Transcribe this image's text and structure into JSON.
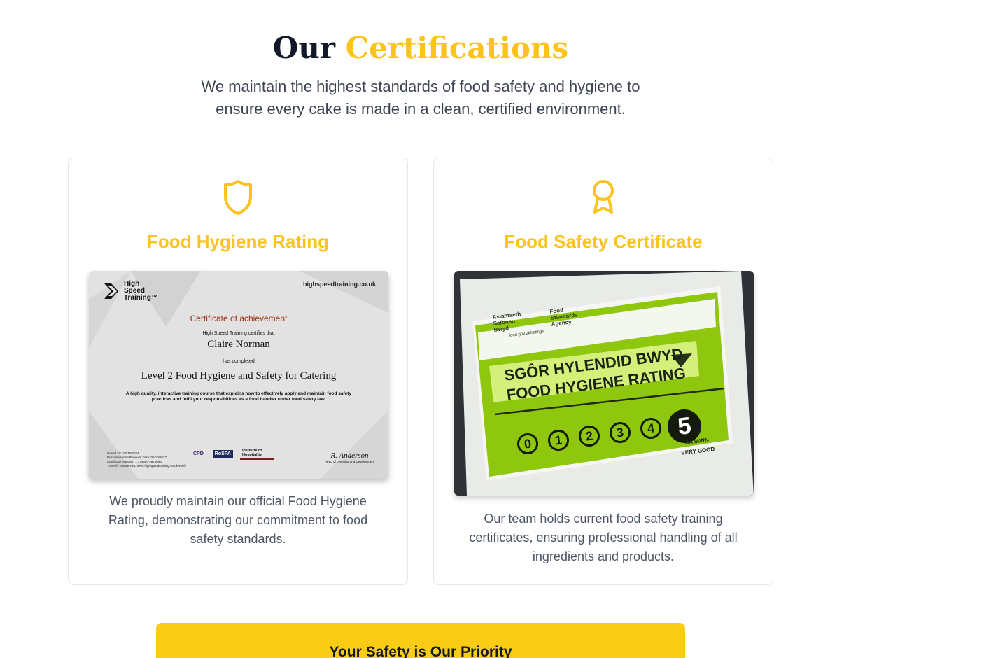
{
  "header": {
    "title_part1": "Our",
    "title_part2": "Certifications",
    "intro_line1": "We maintain the highest standards of food safety and hygiene to",
    "intro_line2": "ensure every cake is made in a clean, certified environment."
  },
  "cards": [
    {
      "title": "Food Hygiene Rating",
      "icon": "shield-icon",
      "desc_line1": "We proudly maintain our official Food Hygiene",
      "desc_line2": "Rating, demonstrating our commitment to food",
      "desc_line3": "safety standards."
    },
    {
      "title": "Food Safety Certificate",
      "icon": "award-ribbon-icon",
      "desc_line1": "Our team holds current food safety training",
      "desc_line2": "certificates, ensuring professional handling of all",
      "desc_line3": "ingredients and products."
    }
  ],
  "certificate": {
    "brand_line1": "High",
    "brand_line2": "Speed",
    "brand_line3": "Training™",
    "url": "highspeedtraining.co.uk",
    "heading": "Certificate of achievement",
    "certifies": "High Speed Training certifies that",
    "name": "Claire Norman",
    "completed": "has completed",
    "course": "Level 2 Food Hygiene and Safety for Catering",
    "description_line1": "A high quality, interactive training course that explains how to effectively apply and maintain food safety",
    "description_line2": "practices and fulfil your responsibilities as a food handler under food safety law.",
    "meta_line1": "Issued On: 06/10/2024",
    "meta_line2": "Recommended Renewal Date: 06/10/2027",
    "meta_line3": "Certificate Number: 7,774850-4678096",
    "meta_line4": "To verify please visit: www.highspeedtraining.co.uk/verify",
    "logo1": "CPD",
    "logo2": "RoSPA",
    "logo3": "Institute of Hospitality",
    "signature": "R. Anderson",
    "signature_role": "Head of Learning and Development"
  },
  "sticker": {
    "agency_welsh_1": "Asiantaeth",
    "agency_welsh_2": "Safonau",
    "agency_welsh_3": "Bwyd",
    "agency_en_1": "Food",
    "agency_en_2": "Standards",
    "agency_en_3": "Agency",
    "site": "food.gov.uk/ratings",
    "title_welsh": "SGÔR HYLENDID BWYD",
    "title_en": "FOOD HYGIENE RATING",
    "scores": [
      "0",
      "1",
      "2",
      "3",
      "4"
    ],
    "rating": "5",
    "rating_fraction": 1.0,
    "label_welsh": "DA IAWN",
    "label_en": "VERY GOOD"
  },
  "banner": {
    "title": "Your Safety is Our Priority"
  },
  "colors": {
    "accent": "#fbc31c",
    "banner": "#facc15",
    "sticker_green": "#9bd40f"
  }
}
